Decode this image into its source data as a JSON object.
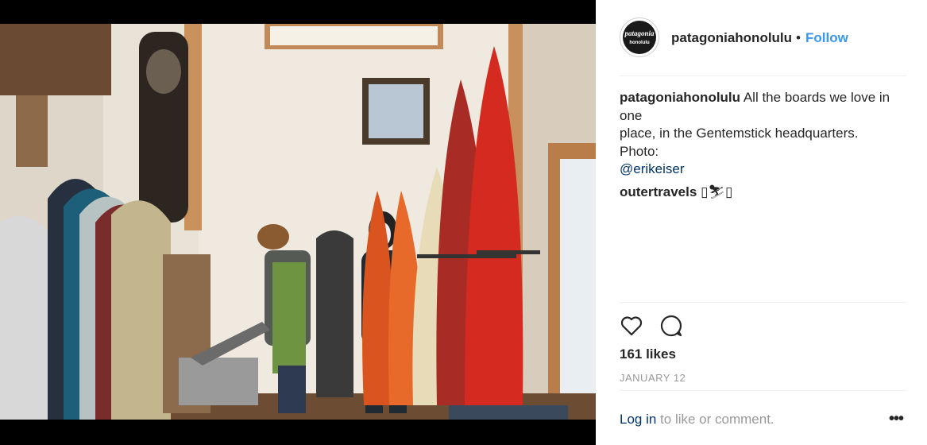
{
  "post": {
    "username": "patagoniahonolulu",
    "dot": "•",
    "follow_label": "Follow",
    "avatar": {
      "brand": "patagonia",
      "location": "honolulu"
    },
    "caption": {
      "username": "patagoniahonolulu",
      "line1": "All the boards we love in",
      "line2": "one",
      "line3": "place, in the Gentemstick headquarters.",
      "line4": "Photo:",
      "mention": "@erikeiser"
    },
    "comment": {
      "username": "outertravels",
      "text": "▯⛷▯"
    },
    "likes": "161 likes",
    "date": "JANUARY 12",
    "login_link": "Log in",
    "login_rest": " to like or comment.",
    "more": "•••"
  }
}
